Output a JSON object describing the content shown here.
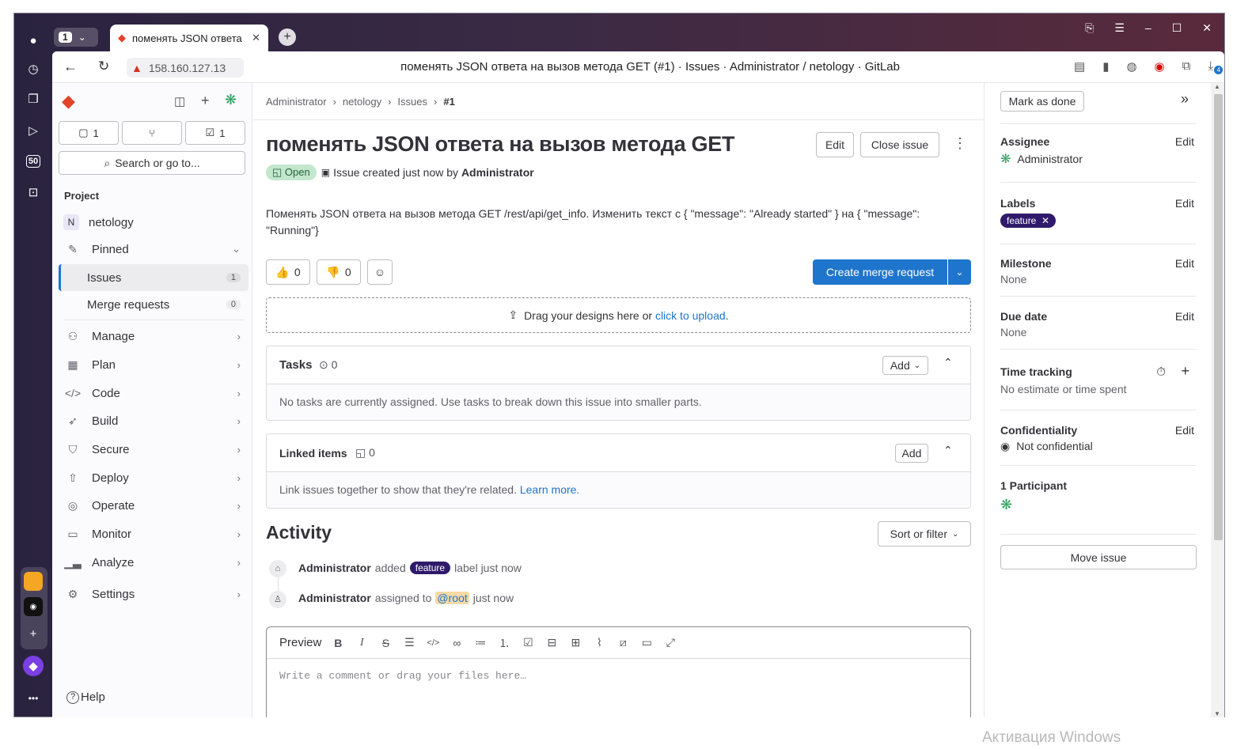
{
  "browser": {
    "tab_count": "1",
    "tab_title": "поменять JSON ответа",
    "address": "158.160.127.13",
    "page_title": "поменять JSON ответа на вызов метода GET (#1) · Issues · Administrator / netology · GitLab",
    "rail_badge": "50",
    "download_badge": "4"
  },
  "sidebar": {
    "counts": {
      "issues": "1",
      "mrs": "",
      "todos": "1"
    },
    "search": "Search or go to...",
    "section": "Project",
    "project_initial": "N",
    "project": "netology",
    "pinned": "Pinned",
    "issues": "Issues",
    "issues_count": "1",
    "mrs": "Merge requests",
    "mrs_count": "0",
    "items": [
      "Manage",
      "Plan",
      "Code",
      "Build",
      "Secure",
      "Deploy",
      "Operate",
      "Monitor",
      "Analyze"
    ],
    "settings": "Settings",
    "help": "Help"
  },
  "breadcrumb": {
    "a": "Administrator",
    "b": "netology",
    "c": "Issues",
    "d": "#1"
  },
  "issue": {
    "title": "поменять JSON ответа на вызов метода GET",
    "status": "Open",
    "meta_prefix": "Issue created just now by ",
    "author": "Administrator",
    "description": "Поменять JSON ответа на вызов метода GET /rest/api/get_info. Изменить текст с { \"message\": \"Already started\" } на { \"message\": \"Running\"}",
    "edit": "Edit",
    "close": "Close issue",
    "thumbs_up": "0",
    "thumbs_down": "0",
    "create_mr": "Create merge request",
    "upload_text": "Drag your designs here or ",
    "upload_link": "click to upload",
    "upload_end": "."
  },
  "tasks": {
    "title": "Tasks",
    "count": "0",
    "add": "Add",
    "empty": "No tasks are currently assigned. Use tasks to break down this issue into smaller parts."
  },
  "linked": {
    "title": "Linked items",
    "count": "0",
    "add": "Add",
    "empty": "Link issues together to show that they're related. ",
    "learn": "Learn more."
  },
  "activity": {
    "title": "Activity",
    "sort": "Sort or filter",
    "e1_user": "Administrator",
    "e1_text": "added",
    "e1_label": "feature",
    "e1_tail": "label just now",
    "e2_user": "Administrator",
    "e2_text": "assigned to",
    "e2_mention": "@root",
    "e2_tail": "just now"
  },
  "editor": {
    "preview": "Preview",
    "placeholder": "Write a comment or drag your files here…"
  },
  "right": {
    "mark_done": "Mark as done",
    "assignee_t": "Assignee",
    "assignee_v": "Administrator",
    "labels_t": "Labels",
    "label": "feature",
    "milestone_t": "Milestone",
    "milestone_v": "None",
    "due_t": "Due date",
    "due_v": "None",
    "time_t": "Time tracking",
    "time_v": "No estimate or time spent",
    "conf_t": "Confidentiality",
    "conf_v": "Not confidential",
    "part_t": "1 Participant",
    "move": "Move issue",
    "edit": "Edit"
  },
  "watermark": "Активация Windows",
  "colors": {
    "primary": "#1f75cb",
    "label": "#2f1a6b",
    "open_bg": "#c3e6cd",
    "open_fg": "#24663b"
  }
}
